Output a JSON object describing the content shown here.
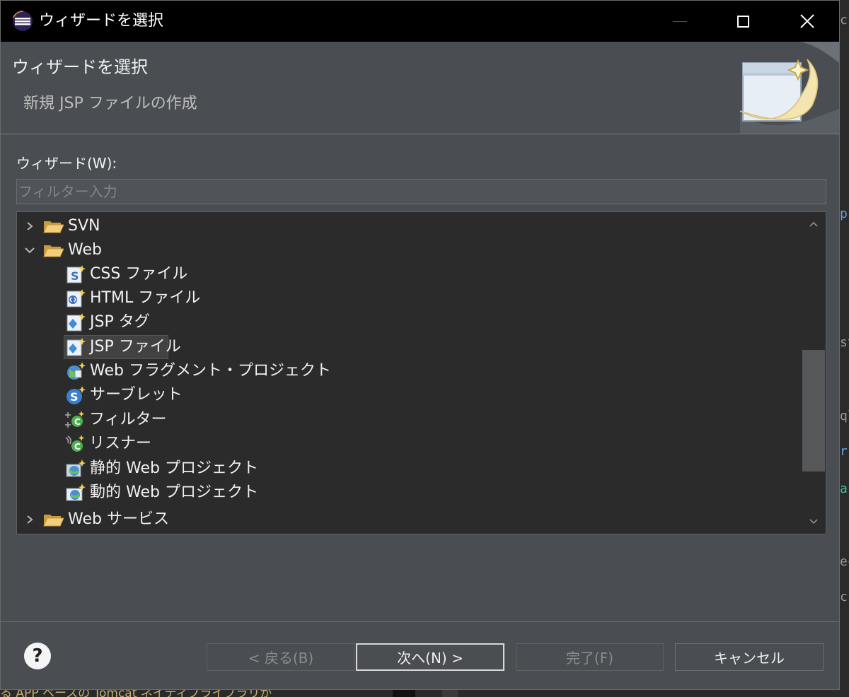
{
  "window": {
    "title": "ウィザードを選択"
  },
  "header": {
    "title": "ウィザードを選択",
    "subtitle": "新規 JSP ファイルの作成"
  },
  "wizard_label": "ウィザード(W):",
  "filter": {
    "placeholder": "フィルター入力",
    "value": ""
  },
  "tree": {
    "items": [
      {
        "label": "SVN",
        "expanded": false,
        "icon": "folder-icon"
      },
      {
        "label": "Web",
        "expanded": true,
        "icon": "folder-open-icon"
      },
      {
        "label": "CSS ファイル",
        "icon": "css-file-icon"
      },
      {
        "label": "HTML ファイル",
        "icon": "html-file-icon"
      },
      {
        "label": "JSP タグ",
        "icon": "jsp-tag-icon"
      },
      {
        "label": "JSP ファイル",
        "icon": "jsp-file-icon",
        "selected": true
      },
      {
        "label": "Web フラグメント・プロジェクト",
        "icon": "web-fragment-project-icon"
      },
      {
        "label": "サーブレット",
        "icon": "servlet-icon"
      },
      {
        "label": "フィルター",
        "icon": "filter-icon"
      },
      {
        "label": "リスナー",
        "icon": "listener-icon"
      },
      {
        "label": "静的 Web プロジェクト",
        "icon": "static-web-project-icon"
      },
      {
        "label": "動的 Web プロジェクト",
        "icon": "dynamic-web-project-icon"
      },
      {
        "label": "Web サービス",
        "expanded": false,
        "icon": "folder-icon"
      }
    ]
  },
  "buttons": {
    "help": "?",
    "back": "< 戻る(B)",
    "next": "次へ(N) >",
    "finish": "完了(F)",
    "cancel": "キャンセル"
  },
  "background": {
    "bottom_text": "る APP ベースの Tomcat ネイティブライブラリが",
    "right_chars": [
      "c",
      "p",
      "st",
      "ql",
      "r",
      "a",
      "ec",
      "c"
    ]
  },
  "colors": {
    "dialog_bg": "#4a4e52",
    "titlebar_bg": "#000000",
    "tree_bg": "#2b2b2b",
    "selection_bg": "#424242"
  }
}
